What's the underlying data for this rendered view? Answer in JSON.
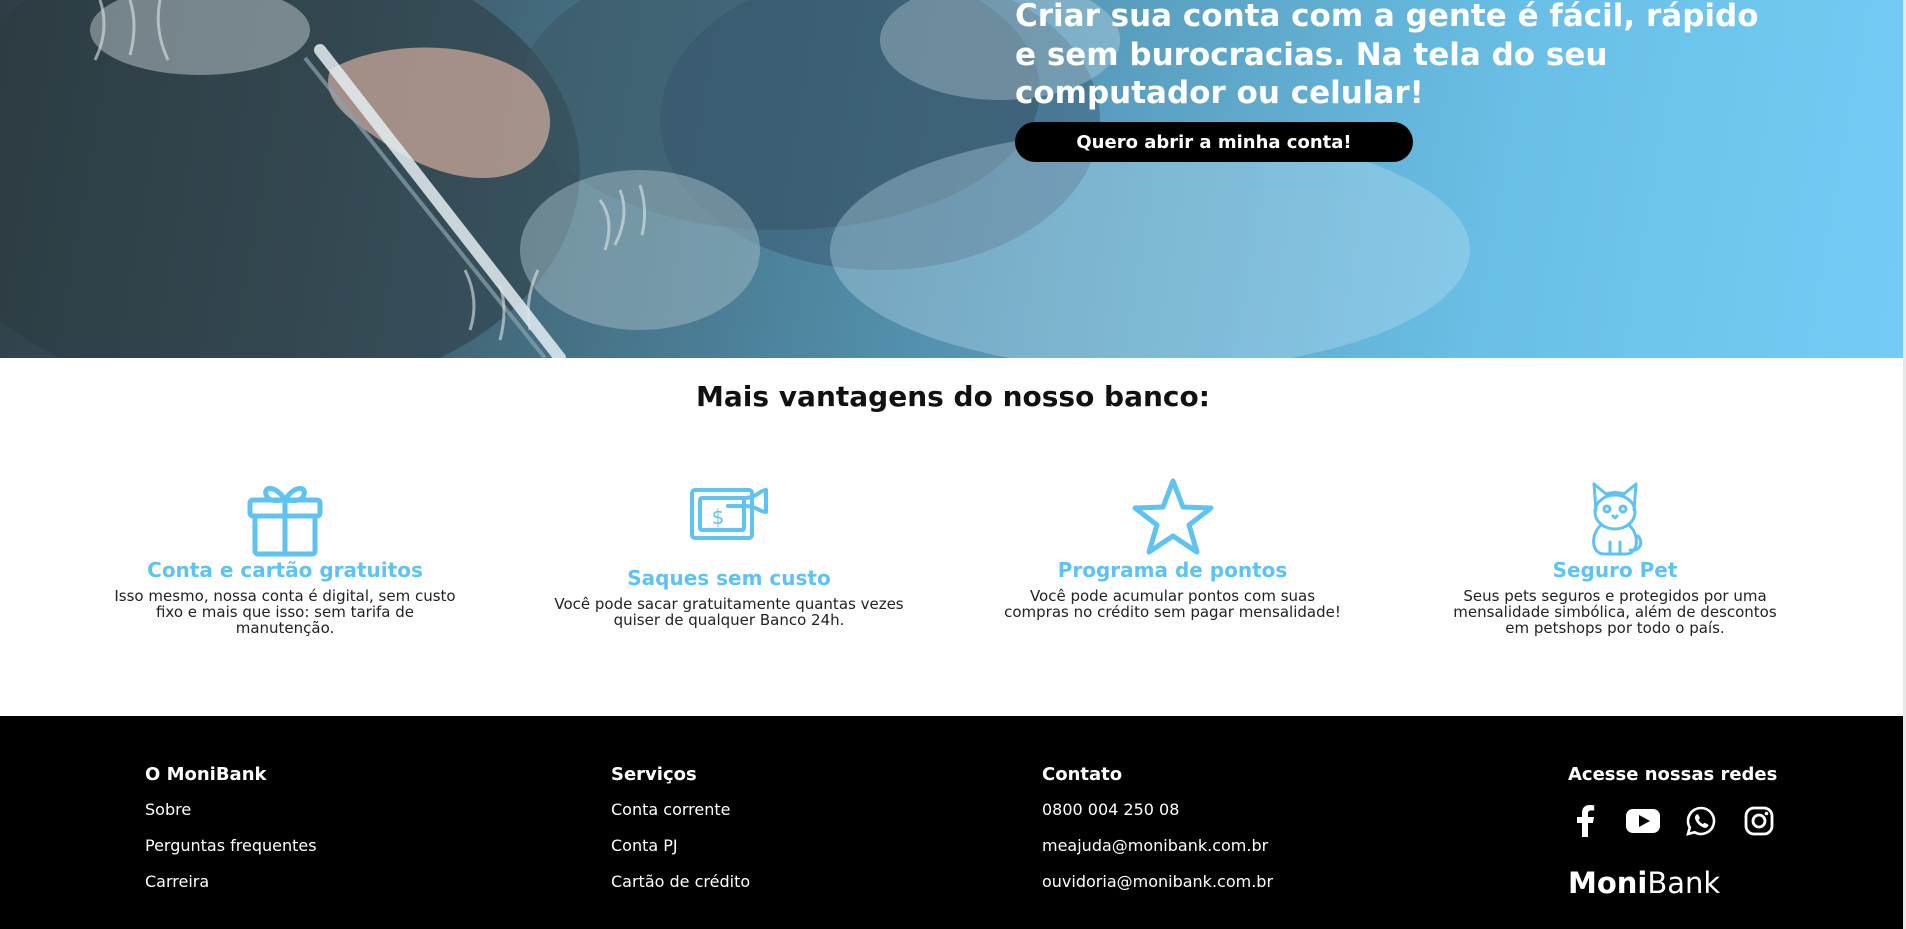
{
  "hero": {
    "headline": "Criar sua conta com a gente é fácil, rápido e sem burocracias. Na tela do seu computador ou celular!",
    "cta_label": "Quero abrir a minha conta!"
  },
  "benefits": {
    "title": "Mais vantagens do nosso banco:",
    "items": [
      {
        "icon": "gift-icon",
        "title": "Conta e cartão gratuitos",
        "description": "Isso mesmo, nossa conta é digital, sem custo fixo e mais que isso: sem tarifa de manutenção."
      },
      {
        "icon": "cash-withdrawal-icon",
        "title": "Saques sem custo",
        "description": "Você pode sacar gratuitamente quantas vezes quiser de qualquer Banco 24h."
      },
      {
        "icon": "star-icon",
        "title": "Programa de pontos",
        "description": "Você pode acumular pontos com suas compras no crédito sem pagar mensalidade!"
      },
      {
        "icon": "cat-icon",
        "title": "Seguro Pet",
        "description": "Seus pets seguros e protegidos por uma mensalidade simbólica, além de descontos em petshops por todo o país."
      }
    ],
    "accent_color": "#5ec3f0"
  },
  "footer": {
    "col1": {
      "title": "O MoniBank",
      "links": [
        "Sobre",
        "Perguntas frequentes",
        "Carreira"
      ]
    },
    "col2": {
      "title": "Serviços",
      "links": [
        "Conta corrente",
        "Conta PJ",
        "Cartão de crédito"
      ]
    },
    "col3": {
      "title": "Contato",
      "links": [
        "0800 004 250 08",
        "meajuda@monibank.com.br",
        "ouvidoria@monibank.com.br"
      ]
    },
    "col4": {
      "title": "Acesse nossas redes",
      "socials": [
        "facebook-icon",
        "youtube-icon",
        "whatsapp-icon",
        "instagram-icon"
      ],
      "brand_bold": "Moni",
      "brand_regular": "Bank"
    }
  }
}
